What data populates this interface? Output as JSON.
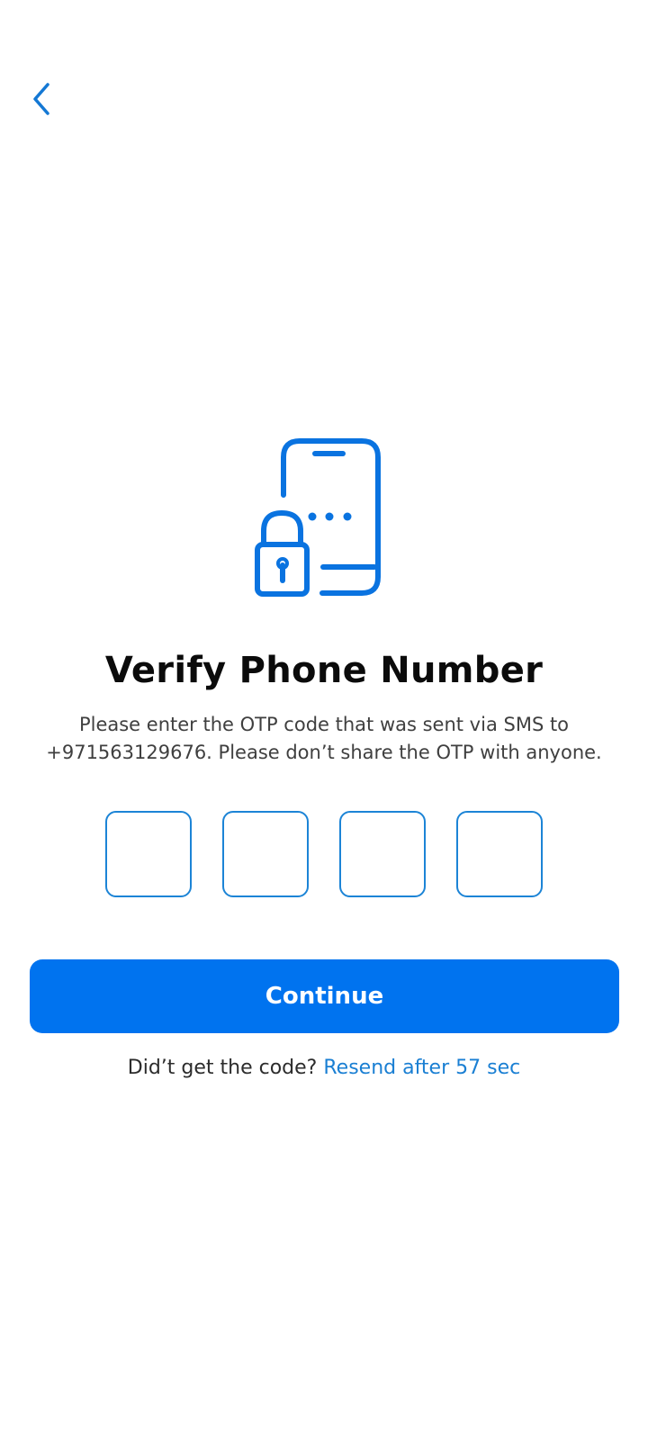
{
  "header": {
    "back_icon": "chevron-left-icon"
  },
  "hero": {
    "icon": "phone-lock-icon"
  },
  "main": {
    "title": "Verify Phone Number",
    "description": "Please enter the OTP code that was sent via SMS to +971563129676. Please don’t share the OTP with anyone.",
    "otp": {
      "digits": [
        "",
        "",
        "",
        ""
      ]
    },
    "continue_label": "Continue",
    "resend_prompt": "Did’t get the code?",
    "resend_link": "Resend after 57 sec"
  },
  "colors": {
    "accent": "#0073ef",
    "link": "#1a7fd3",
    "icon": "#0a73e0"
  }
}
